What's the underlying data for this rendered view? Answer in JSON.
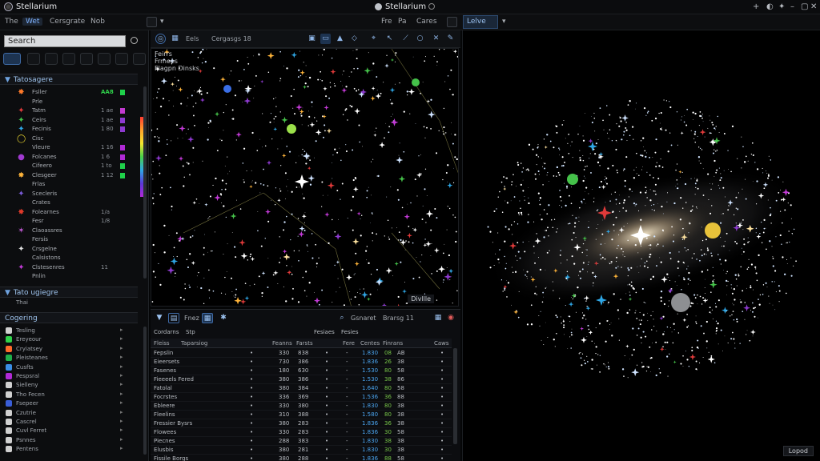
{
  "titlebar": {
    "app_name": "Stellarium",
    "center_title": "Stellarium",
    "controls": [
      "+",
      "◐",
      "✦",
      "–",
      "▢",
      "✕"
    ]
  },
  "menubar": {
    "items": [
      "The",
      "Wet",
      "Cersgrate",
      "Nob"
    ],
    "right_items": [
      "Fre",
      "Pa",
      "Cares"
    ],
    "view_tab": "Lelve"
  },
  "sidebar": {
    "search_placeholder": "Search",
    "section1": "Tatosagere",
    "objects": [
      {
        "name": "Fsller",
        "val": "AA8",
        "glyph": "✸",
        "color": "#ff7a2a",
        "sq": "#1fd14a"
      },
      {
        "name": "Prle",
        "val": "",
        "glyph": "",
        "color": "#888",
        "sq": ""
      },
      {
        "name": "Tatm",
        "val": "1 ae",
        "glyph": "✦",
        "color": "#e03a3a",
        "sq": "#c33ad0"
      },
      {
        "name": "Ceirs",
        "val": "1 ae",
        "glyph": "✦",
        "color": "#45c24a",
        "sq": "#8e3ad0"
      },
      {
        "name": "Fecinis",
        "val": "1 80",
        "glyph": "✦",
        "color": "#2fa7e6",
        "sq": "#8e3ad0"
      },
      {
        "name": "Cisc",
        "val": "",
        "glyph": "◯",
        "color": "#e6d22e",
        "sq": ""
      },
      {
        "name": "Vleure",
        "val": "1 16",
        "glyph": "",
        "color": "#888",
        "sq": "#b12ad6"
      },
      {
        "name": "Folcanes",
        "val": "1 6",
        "glyph": "●",
        "color": "#a13ad0",
        "sq": "#b12ad6"
      },
      {
        "name": "Cifeero",
        "val": "1 to",
        "glyph": "",
        "color": "#888",
        "sq": "#1fd14a"
      },
      {
        "name": "Clesgeer",
        "val": "1 12",
        "glyph": "✸",
        "color": "#ffb43a",
        "sq": "#1fd14a"
      },
      {
        "name": "Frlas",
        "val": "",
        "glyph": "",
        "color": "#888",
        "sq": ""
      },
      {
        "name": "Scecleris",
        "val": "",
        "glyph": "✦",
        "color": "#7a5bd8",
        "sq": ""
      },
      {
        "name": "Crates",
        "val": "",
        "glyph": "",
        "color": "#888",
        "sq": ""
      },
      {
        "name": "Folearnes",
        "val": "1/a",
        "glyph": "✸",
        "color": "#e03a2a",
        "sq": ""
      },
      {
        "name": "Fesr",
        "val": "1/8",
        "glyph": "",
        "color": "#888",
        "sq": ""
      },
      {
        "name": "Claoassres",
        "val": "",
        "glyph": "✶",
        "color": "#c25ad6",
        "sq": ""
      },
      {
        "name": "Fersis",
        "val": "",
        "glyph": "",
        "color": "#888",
        "sq": ""
      },
      {
        "name": "Crsgelne",
        "val": "",
        "glyph": "✦",
        "color": "#e0e0e0",
        "sq": ""
      },
      {
        "name": "Calsistons",
        "val": "",
        "glyph": "",
        "color": "#888",
        "sq": ""
      },
      {
        "name": "Clstesenres",
        "val": "11",
        "glyph": "✦",
        "color": "#c13ad6",
        "sq": ""
      },
      {
        "name": "Pnlin",
        "val": "",
        "glyph": "",
        "color": "#888",
        "sq": ""
      }
    ],
    "section2": "Tato ugiegre",
    "section2_item": "Thai",
    "section3": "Cogering",
    "colors": [
      {
        "label": "Tesling",
        "color": "#d0d0d0"
      },
      {
        "label": "Ereyeour",
        "color": "#2fd14a"
      },
      {
        "label": "Cryiatsey",
        "color": "#ff6a2a"
      },
      {
        "label": "Pleisteanes",
        "color": "#1fb04a"
      },
      {
        "label": "Cusfts",
        "color": "#3a8ee6"
      },
      {
        "label": "Pespsral",
        "color": "#b12ad6"
      },
      {
        "label": "Sielleny",
        "color": "#d0d0d0"
      },
      {
        "label": "Tho Fecen",
        "color": "#d0d0d0"
      },
      {
        "label": "Fsepeer",
        "color": "#3a5ed8"
      },
      {
        "label": "Czutrie",
        "color": "#d0d0d0"
      },
      {
        "label": "Cascrel",
        "color": "#d0d0d0"
      },
      {
        "label": "Cuvl Ferret",
        "color": "#d0d0d0"
      },
      {
        "label": "Psnnes",
        "color": "#d0d0d0"
      },
      {
        "label": "Pentens",
        "color": "#d0d0d0"
      }
    ]
  },
  "center": {
    "toolbar_label1": "Eels",
    "toolbar_label2": "Cergasgs 18",
    "sky_labels": [
      "Feirrs",
      "Frmees",
      "Flagpn Dinsks"
    ],
    "sky_status": "Divllle"
  },
  "table": {
    "tabs": [
      "Fnez",
      "Gsnaret"
    ],
    "search_text": "Brarsg 11",
    "title_row": [
      "Cordarns",
      "Stp",
      "Fesiaes",
      "Fesies"
    ],
    "columns": [
      "Fleiss",
      "Taparsiog",
      "Feanns",
      "Farsts",
      "Fere",
      "Centes",
      "Finrans",
      "Caws"
    ],
    "rows": [
      {
        "name": "Fepslin",
        "a": "330",
        "b": "838",
        "c": "1.830",
        "d": "08",
        "e": "AB"
      },
      {
        "name": "Eieersets",
        "a": "730",
        "b": "386",
        "c": "1.836",
        "d": "26",
        "e": "38"
      },
      {
        "name": "Fasenes",
        "a": "180",
        "b": "630",
        "c": "1.530",
        "d": "80",
        "e": "58"
      },
      {
        "name": "Fieeeels Fered",
        "a": "380",
        "b": "386",
        "c": "1.530",
        "d": "38",
        "e": "86"
      },
      {
        "name": "Fatolal",
        "a": "380",
        "b": "384",
        "c": "1.640",
        "d": "80",
        "e": "58"
      },
      {
        "name": "Focrstes",
        "a": "336",
        "b": "369",
        "c": "1.536",
        "d": "36",
        "e": "88"
      },
      {
        "name": "Ebleere",
        "a": "330",
        "b": "380",
        "c": "1.830",
        "d": "80",
        "e": "38"
      },
      {
        "name": "Fleelins",
        "a": "310",
        "b": "388",
        "c": "1.580",
        "d": "80",
        "e": "38"
      },
      {
        "name": "Fressier Bysrs",
        "a": "380",
        "b": "283",
        "c": "1.836",
        "d": "36",
        "e": "38"
      },
      {
        "name": "Flowees",
        "a": "330",
        "b": "283",
        "c": "1.836",
        "d": "30",
        "e": "58"
      },
      {
        "name": "Piecnes",
        "a": "288",
        "b": "383",
        "c": "1.830",
        "d": "38",
        "e": "38"
      },
      {
        "name": "Elusbis",
        "a": "380",
        "b": "281",
        "c": "1.830",
        "d": "30",
        "e": "38"
      },
      {
        "name": "Fissile Borgs",
        "a": "380",
        "b": "288",
        "c": "1.836",
        "d": "88",
        "e": "58"
      }
    ]
  },
  "galaxy": {
    "status": "Lopod"
  }
}
